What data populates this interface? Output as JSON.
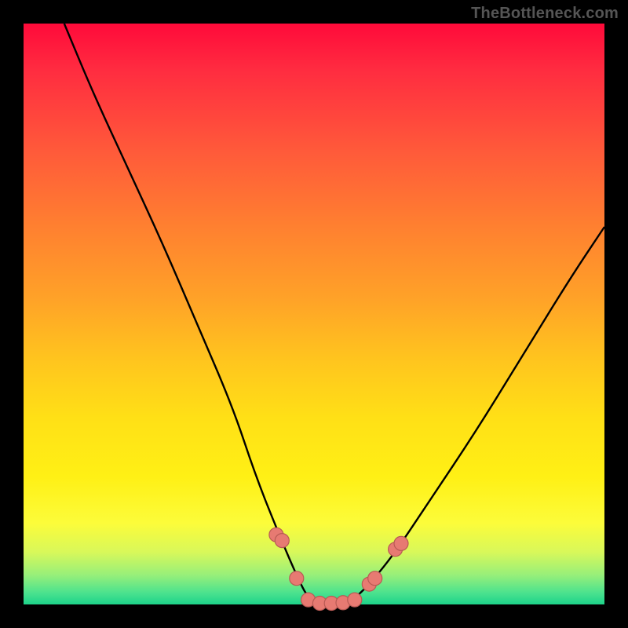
{
  "watermark": "TheBottleneck.com",
  "colors": {
    "background": "#000000",
    "gradient_top": "#ff0a3a",
    "gradient_bottom": "#1dd38a",
    "curve": "#000000",
    "marker_fill": "#e77a72",
    "marker_stroke": "#b85a54"
  },
  "chart_data": {
    "type": "line",
    "title": "",
    "xlabel": "",
    "ylabel": "",
    "xlim": [
      0,
      100
    ],
    "ylim": [
      0,
      100
    ],
    "note": "Axes unlabeled; values are normalized 0–100. y=0 is bottom (green), y=100 is top (red). A V-shaped bottleneck curve.",
    "series": [
      {
        "name": "bottleneck-curve",
        "x": [
          7,
          12,
          18,
          24,
          30,
          36,
          40,
          44,
          47,
          49,
          51,
          53,
          55,
          57,
          60,
          64,
          70,
          78,
          86,
          94,
          100
        ],
        "y": [
          100,
          88,
          75,
          62,
          48,
          34,
          22,
          12,
          5,
          1,
          0,
          0,
          0,
          1,
          4,
          9,
          18,
          30,
          43,
          56,
          65
        ]
      }
    ],
    "markers": {
      "name": "highlighted-points",
      "x": [
        43.5,
        44.5,
        47.0,
        49.0,
        51.0,
        53.0,
        55.0,
        57.0,
        59.5,
        60.5,
        64.0,
        65.0
      ],
      "y": [
        12.0,
        11.0,
        4.5,
        0.8,
        0.2,
        0.2,
        0.3,
        0.8,
        3.5,
        4.5,
        9.5,
        10.5
      ]
    }
  }
}
